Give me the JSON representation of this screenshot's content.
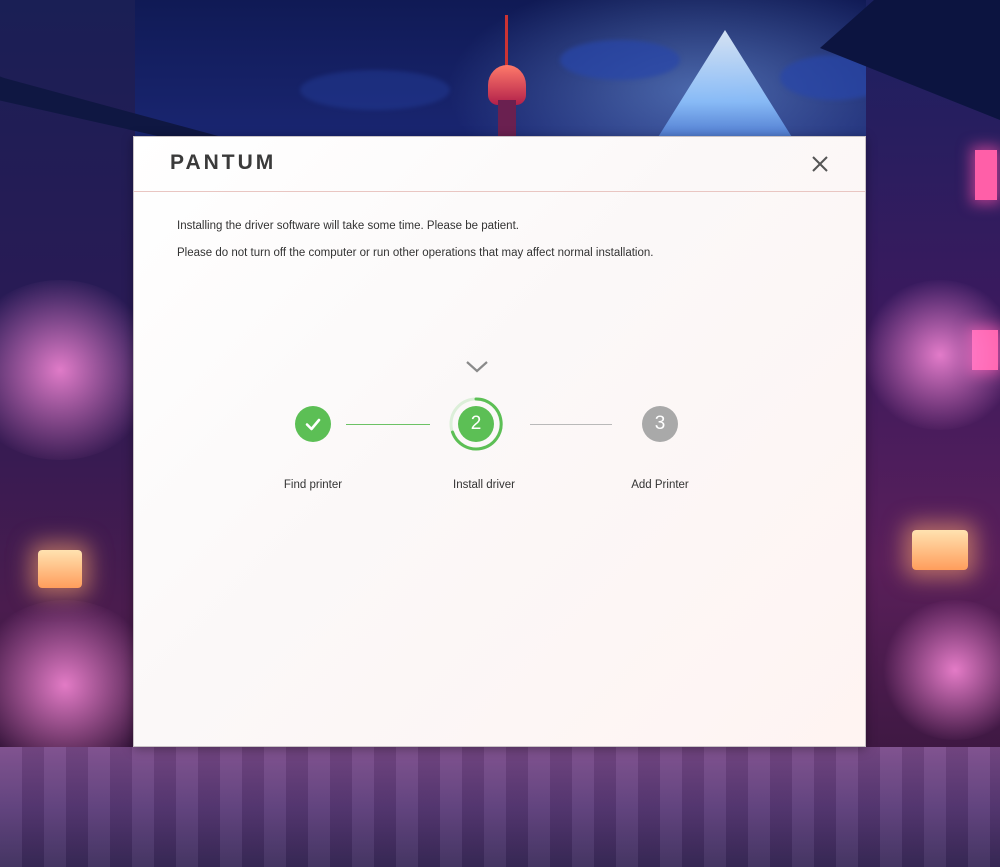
{
  "dialog": {
    "brand": "PANTUM",
    "close_icon": "close-icon",
    "messages": [
      "Installing the driver software will take some time. Please be patient.",
      "Please do not turn off the computer or run other operations that may affect normal installation."
    ],
    "indicator_icon": "chevron-down-icon",
    "steps": [
      {
        "label": "Find printer",
        "state": "done",
        "icon": "check-icon"
      },
      {
        "label": "Install driver",
        "state": "active",
        "number": "2"
      },
      {
        "label": "Add Printer",
        "state": "pending",
        "number": "3"
      }
    ],
    "colors": {
      "accent_green": "#5cbf55",
      "pending_gray": "#a9a9a9",
      "header_divider": "#e9c6c2",
      "text": "#333333"
    }
  }
}
